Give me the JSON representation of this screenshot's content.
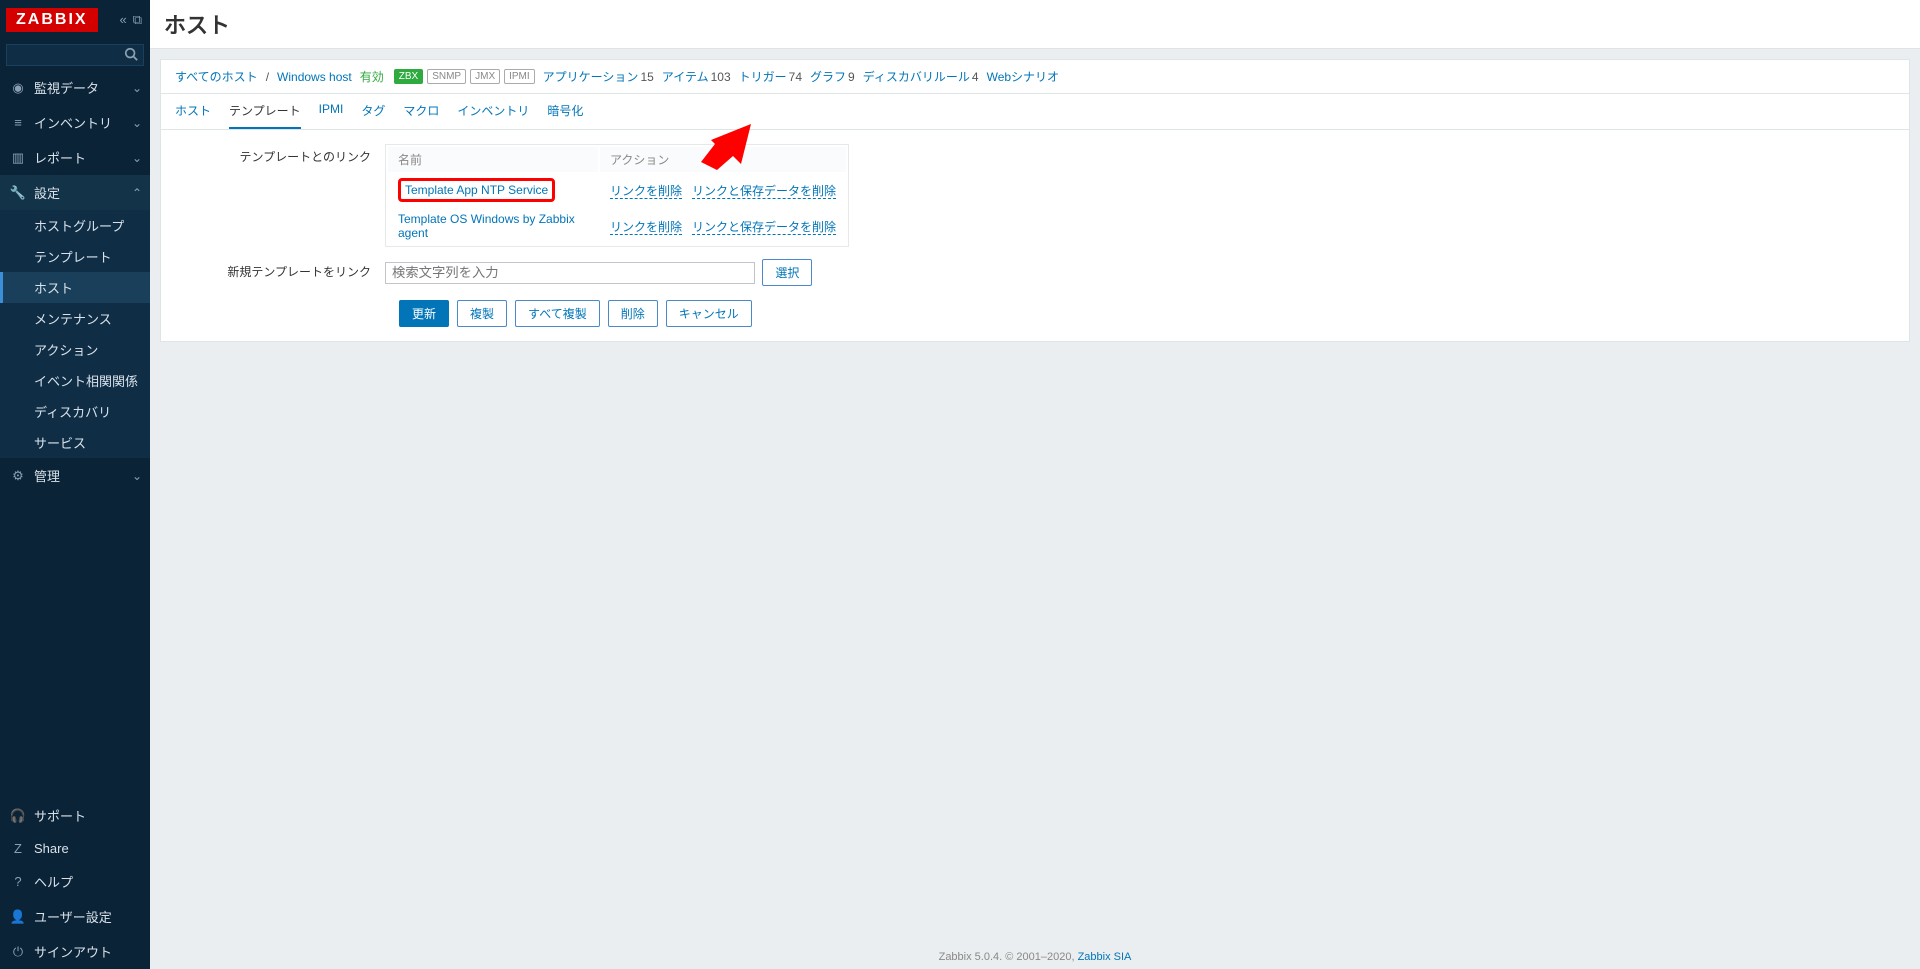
{
  "brand": "ZABBIX",
  "search": {
    "placeholder": ""
  },
  "nav": {
    "monitoring": "監視データ",
    "inventory": "インベントリ",
    "reports": "レポート",
    "settings": "設定",
    "administration": "管理"
  },
  "subnav": {
    "hostgroup": "ホストグループ",
    "template": "テンプレート",
    "host": "ホスト",
    "maintenance": "メンテナンス",
    "action": "アクション",
    "correlation": "イベント相関関係",
    "discovery": "ディスカバリ",
    "service": "サービス"
  },
  "footer_nav": {
    "support": "サポート",
    "share": "Share",
    "help": "ヘルプ",
    "usersettings": "ユーザー設定",
    "signout": "サインアウト"
  },
  "page_title": "ホスト",
  "breadcrumb": {
    "all_hosts": "すべてのホスト",
    "current": "Windows host",
    "status": "有効",
    "badges": {
      "zbx": "ZBX",
      "snmp": "SNMP",
      "jmx": "JMX",
      "ipmi": "IPMI"
    },
    "application": {
      "label": "アプリケーション",
      "count": "15"
    },
    "items": {
      "label": "アイテム",
      "count": "103"
    },
    "triggers": {
      "label": "トリガー",
      "count": "74"
    },
    "graphs": {
      "label": "グラフ",
      "count": "9"
    },
    "discovery": {
      "label": "ディスカバリルール",
      "count": "4"
    },
    "web": {
      "label": "Webシナリオ",
      "count": ""
    }
  },
  "tabs": {
    "host": "ホスト",
    "template": "テンプレート",
    "ipmi": "IPMI",
    "tag": "タグ",
    "macro": "マクロ",
    "inventory": "インベントリ",
    "encryption": "暗号化"
  },
  "form": {
    "linked_templates_label": "テンプレートとのリンク",
    "col_name": "名前",
    "col_action": "アクション",
    "rows": [
      {
        "name": "Template App NTP Service",
        "unlink": "リンクを削除",
        "clear": "リンクと保存データを削除"
      },
      {
        "name": "Template OS Windows by Zabbix agent",
        "unlink": "リンクを削除",
        "clear": "リンクと保存データを削除"
      }
    ],
    "new_template_label": "新規テンプレートをリンク",
    "new_template_placeholder": "検索文字列を入力",
    "select_btn": "選択"
  },
  "buttons": {
    "update": "更新",
    "clone": "複製",
    "fullclone": "すべて複製",
    "delete": "削除",
    "cancel": "キャンセル"
  },
  "page_footer": {
    "text": "Zabbix 5.0.4. © 2001–2020, ",
    "link": "Zabbix SIA"
  }
}
